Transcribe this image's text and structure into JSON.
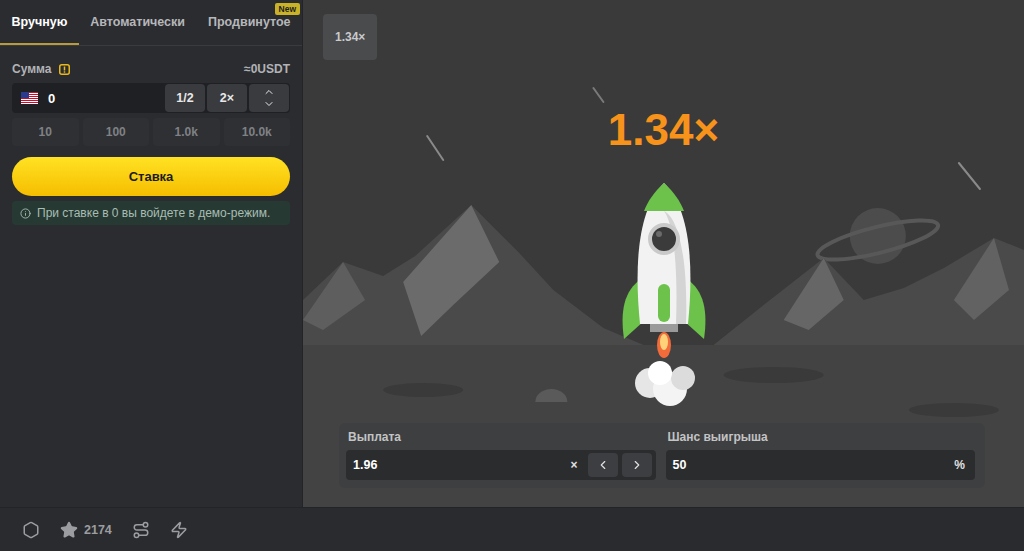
{
  "tabs": [
    {
      "label": "Вручную",
      "selected": true,
      "badge": null
    },
    {
      "label": "Автоматически",
      "selected": false,
      "badge": null
    },
    {
      "label": "Продвинутое",
      "selected": false,
      "badge": "New"
    }
  ],
  "amount": {
    "label": "Сумма",
    "conversion": "≈0USDT",
    "value": "0",
    "half": "1/2",
    "double": "2×"
  },
  "presets": [
    "10",
    "100",
    "1.0k",
    "10.0k"
  ],
  "bet_button": "Ставка",
  "note": "При ставке в 0 вы войдете в демо-режим.",
  "history": [
    "1.34×"
  ],
  "multiplier": "1.34×",
  "payout": {
    "label": "Выплата",
    "value": "1.96",
    "suffix": "×"
  },
  "chance": {
    "label": "Шанс выигрыша",
    "value": "50",
    "suffix": "%"
  },
  "footer": {
    "stars": "2174"
  }
}
